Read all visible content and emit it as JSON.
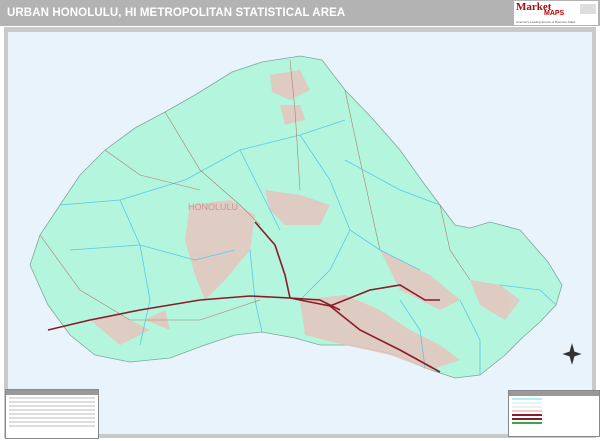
{
  "header": {
    "title": "URBAN HONOLULU, HI METROPOLITAN STATISTICAL AREA"
  },
  "logo": {
    "brand_first": "Market",
    "brand_second": "MAPS",
    "tagline": "America's Leading Source of Business Maps"
  },
  "map": {
    "place_label": "HONOLULU",
    "colors": {
      "land": "#b4f5dd",
      "urban": "#e6c4bd",
      "water": "#e8f3fb",
      "highway": "#8b1a2a",
      "zip_boundary": "#5bc8e8",
      "roads": "#b08070"
    }
  }
}
